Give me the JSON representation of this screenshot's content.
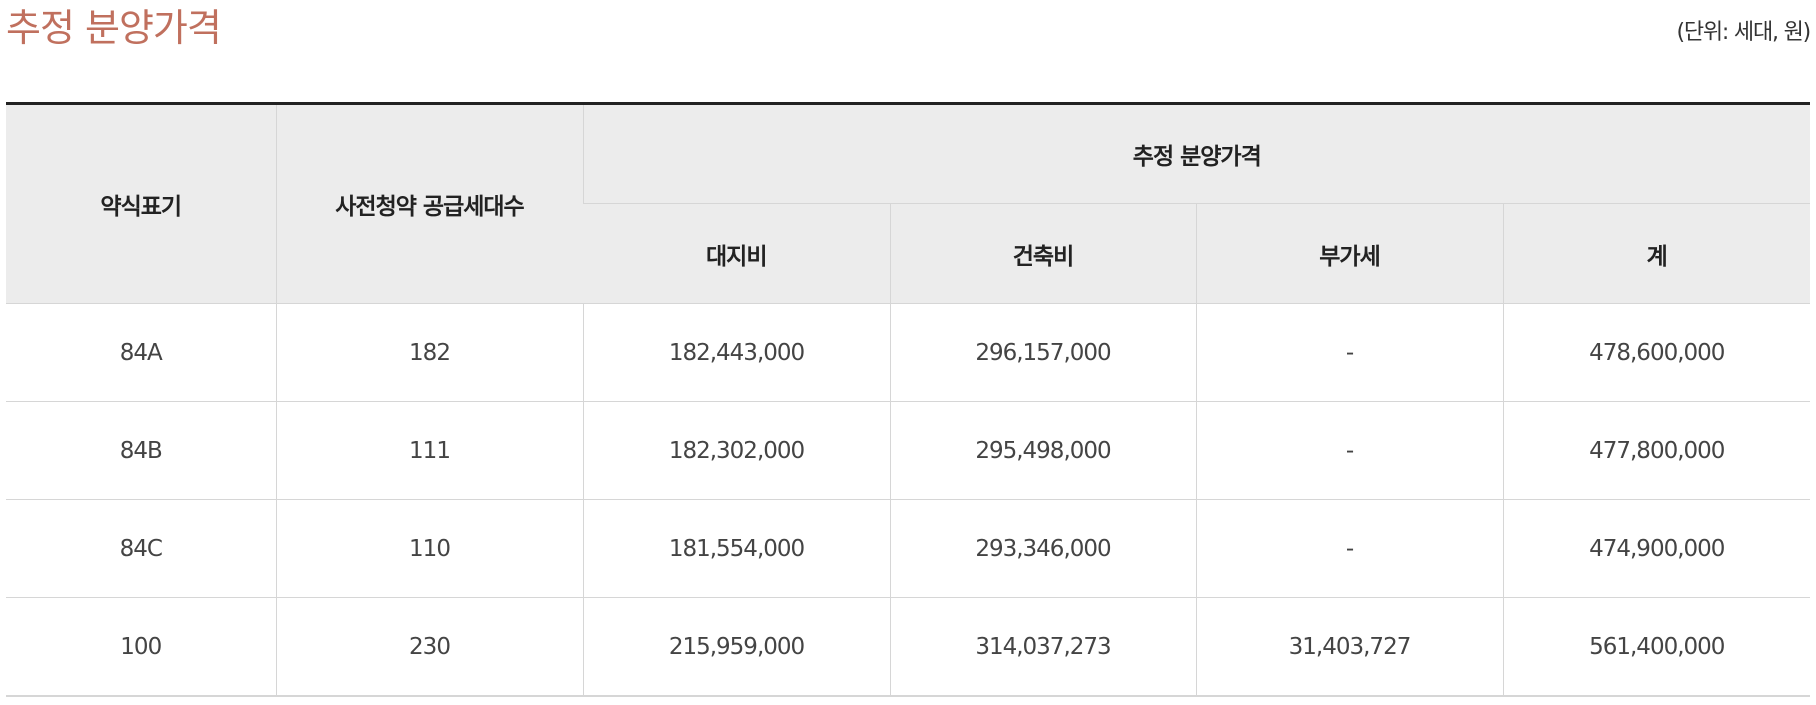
{
  "title": "추정 분양가격",
  "unit_note": "(단위: 세대, 원)",
  "table": {
    "headers": {
      "type": "약식표기",
      "units": "사전청약 공급세대수",
      "price_group": "추정 분양가격",
      "land": "대지비",
      "construction": "건축비",
      "vat": "부가세",
      "total": "계"
    },
    "rows": [
      {
        "type": "84A",
        "units": "182",
        "land": "182,443,000",
        "construction": "296,157,000",
        "vat": "-",
        "total": "478,600,000"
      },
      {
        "type": "84B",
        "units": "111",
        "land": "182,302,000",
        "construction": "295,498,000",
        "vat": "-",
        "total": "477,800,000"
      },
      {
        "type": "84C",
        "units": "110",
        "land": "181,554,000",
        "construction": "293,346,000",
        "vat": "-",
        "total": "474,900,000"
      },
      {
        "type": "100",
        "units": "230",
        "land": "215,959,000",
        "construction": "314,037,273",
        "vat": "31,403,727",
        "total": "561,400,000"
      }
    ]
  },
  "colors": {
    "title": "#c0705e",
    "header_bg": "#ececec",
    "top_border": "#222222",
    "grid": "#d6d6d6"
  }
}
